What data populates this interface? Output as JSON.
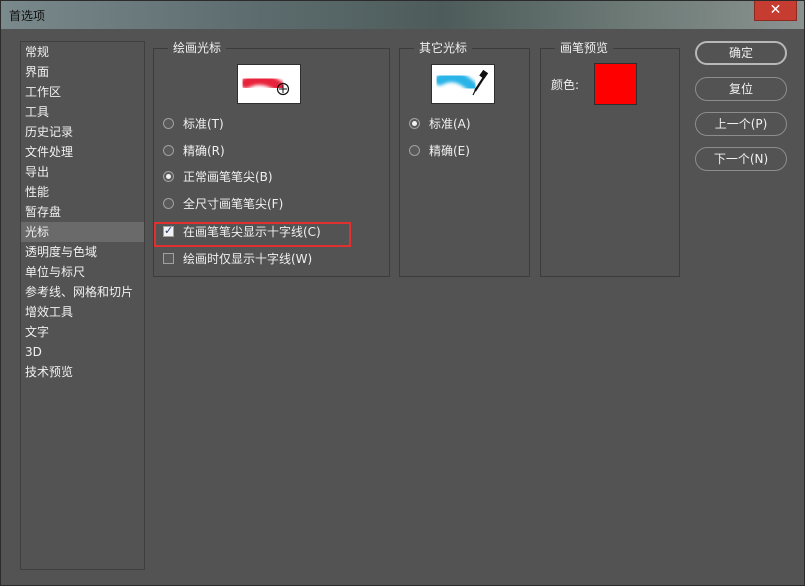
{
  "window": {
    "title": "首选项",
    "close_label": "✕"
  },
  "sidebar": {
    "items": [
      {
        "label": "常规"
      },
      {
        "label": "界面"
      },
      {
        "label": "工作区"
      },
      {
        "label": "工具"
      },
      {
        "label": "历史记录"
      },
      {
        "label": "文件处理"
      },
      {
        "label": "导出"
      },
      {
        "label": "性能"
      },
      {
        "label": "暂存盘"
      },
      {
        "label": "光标"
      },
      {
        "label": "透明度与色域"
      },
      {
        "label": "单位与标尺"
      },
      {
        "label": "参考线、网格和切片"
      },
      {
        "label": "增效工具"
      },
      {
        "label": "文字"
      },
      {
        "label": "3D"
      },
      {
        "label": "技术预览"
      }
    ],
    "selected_index": 9
  },
  "painting_cursors": {
    "title": "绘画光标",
    "options": [
      {
        "label": "标准(T)",
        "checked": false
      },
      {
        "label": "精确(R)",
        "checked": false
      },
      {
        "label": "正常画笔笔尖(B)",
        "checked": true
      },
      {
        "label": "全尺寸画笔笔尖(F)",
        "checked": false
      }
    ],
    "checkboxes": [
      {
        "label": "在画笔笔尖显示十字线(C)",
        "checked": true
      },
      {
        "label": "绘画时仅显示十字线(W)",
        "checked": false
      }
    ]
  },
  "other_cursors": {
    "title": "其它光标",
    "options": [
      {
        "label": "标准(A)",
        "checked": true
      },
      {
        "label": "精确(E)",
        "checked": false
      }
    ]
  },
  "brush_preview": {
    "title": "画笔预览",
    "color_label": "颜色:",
    "color": "#ff0000"
  },
  "buttons": {
    "ok": "确定",
    "reset": "复位",
    "prev": "上一个(P)",
    "next": "下一个(N)"
  },
  "colors": {
    "panel_bg": "#535353",
    "highlight": "#e03030",
    "brush_red": "#e8203a",
    "brush_cyan": "#2ab4e8"
  }
}
